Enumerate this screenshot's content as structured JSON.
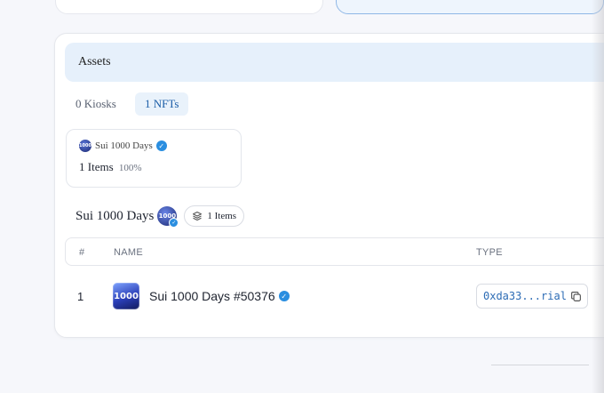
{
  "assets": {
    "title": "Assets",
    "tabs": [
      {
        "label": "0 Kiosks",
        "active": false
      },
      {
        "label": "1 NFTs",
        "active": true
      }
    ]
  },
  "collection_card": {
    "name": "Sui 1000 Days",
    "avatar_text": "1000",
    "items": "1 Items",
    "percent": "100%"
  },
  "section": {
    "title": "Sui 1000 Days",
    "avatar_text": "1000",
    "items_chip": "1 Items"
  },
  "table": {
    "headers": {
      "num": "#",
      "name": "NAME",
      "type": "TYPE"
    },
    "rows": [
      {
        "num": "1",
        "thumb_text": "1000",
        "name": "Sui 1000 Days #50376",
        "type": "0xda33...rial"
      }
    ]
  },
  "colors": {
    "accent": "#2a8ee0",
    "header_bg": "#e6f0fb",
    "type_text": "#2d6cb5"
  },
  "icons": [
    "verified-icon",
    "layers-icon",
    "copy-icon"
  ]
}
